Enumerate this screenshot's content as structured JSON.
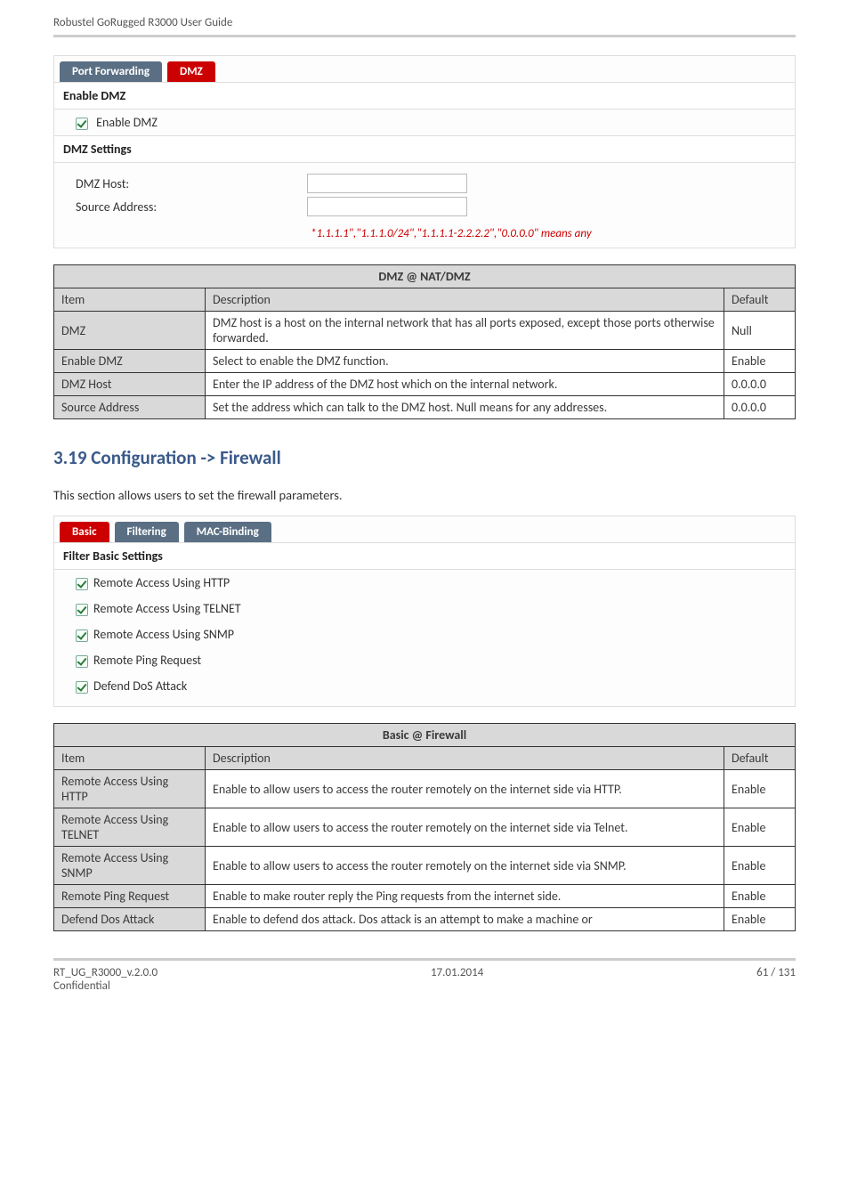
{
  "header": "Robustel GoRugged R3000 User Guide",
  "panel1": {
    "tabs": [
      {
        "label": "Port Forwarding",
        "active": false
      },
      {
        "label": "DMZ",
        "active": true
      }
    ],
    "section1": {
      "title": "Enable DMZ",
      "checkbox_label": "Enable DMZ"
    },
    "section2": {
      "title": "DMZ Settings",
      "field1_label": "DMZ Host:",
      "field2_label": "Source Address:",
      "hint": "*1.1.1.1\",\"1.1.1.0/24\",\"1.1.1.1-2.2.2.2\",\"0.0.0.0\" means any"
    }
  },
  "table1": {
    "title": "DMZ @ NAT/DMZ",
    "col_item": "Item",
    "col_desc": "Description",
    "col_default": "Default",
    "rows": [
      {
        "item": "DMZ",
        "desc": "DMZ host is a host on the internal network that has all ports exposed, except those ports otherwise forwarded.",
        "def": "Null"
      },
      {
        "item": "Enable DMZ",
        "desc": "Select to enable the DMZ function.",
        "def": "Enable"
      },
      {
        "item": "DMZ Host",
        "desc": "Enter the IP address of the DMZ host which on the internal network.",
        "def": "0.0.0.0"
      },
      {
        "item": "Source Address",
        "desc": "Set the address which can talk to the DMZ host. Null means for any addresses.",
        "def": "0.0.0.0"
      }
    ]
  },
  "section_heading": "3.19  Configuration -> Firewall",
  "intro": "This section allows users to set the firewall parameters.",
  "panel2": {
    "tabs": [
      {
        "label": "Basic",
        "active": true
      },
      {
        "label": "Filtering",
        "active": false
      },
      {
        "label": "MAC-Binding",
        "active": false
      }
    ],
    "section1": {
      "title": "Filter Basic Settings",
      "checks": [
        "Remote Access Using HTTP",
        "Remote Access Using TELNET",
        "Remote Access Using SNMP",
        "Remote Ping Request",
        "Defend DoS Attack"
      ]
    }
  },
  "table2": {
    "title": "Basic @ Firewall",
    "col_item": "Item",
    "col_desc": "Description",
    "col_default": "Default",
    "rows": [
      {
        "item": "Remote Access Using HTTP",
        "desc": "Enable to allow users to access the router remotely on the internet side via HTTP.",
        "def": "Enable"
      },
      {
        "item": "Remote Access Using TELNET",
        "desc": "Enable to allow users to access the router remotely on the internet side via Telnet.",
        "def": "Enable"
      },
      {
        "item": "Remote Access Using SNMP",
        "desc": "Enable to allow users to access the router remotely on the internet side via SNMP.",
        "def": "Enable"
      },
      {
        "item": "Remote Ping Request",
        "desc": "Enable to make router reply the Ping requests from the internet side.",
        "def": "Enable"
      },
      {
        "item": "Defend Dos Attack",
        "desc": "Enable to defend dos attack. Dos attack is an attempt to make a machine or",
        "def": "Enable"
      }
    ]
  },
  "footer": {
    "left1": "RT_UG_R3000_v.2.0.0",
    "left2": "Confidential",
    "center": "17.01.2014",
    "right": "61 / 131"
  }
}
